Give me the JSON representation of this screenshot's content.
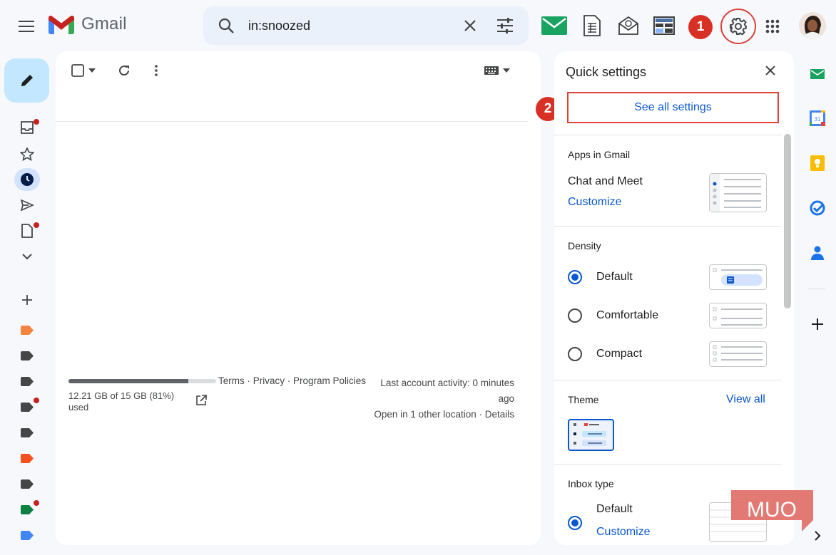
{
  "app": {
    "name": "Gmail"
  },
  "search": {
    "value": "in:snoozed"
  },
  "callouts": {
    "one": "1",
    "two": "2"
  },
  "storage": {
    "used_text": "12.21 GB of 15 GB (81%) used",
    "fraction": 0.81
  },
  "footer": {
    "links": "Terms · Privacy · Program Policies",
    "activity_line1": "Last account activity: 0 minutes",
    "activity_line2": "ago",
    "activity_line3": "Open in 1 other location · Details"
  },
  "quick_settings": {
    "title": "Quick settings",
    "see_all": "See all settings",
    "apps_label": "Apps in Gmail",
    "chat_meet": "Chat and Meet",
    "customize": "Customize",
    "density_label": "Density",
    "density_options": [
      "Default",
      "Comfortable",
      "Compact"
    ],
    "density_selected": "Default",
    "theme_label": "Theme",
    "theme_view_all": "View all",
    "inbox_type_label": "Inbox type",
    "inbox_default": "Default",
    "inbox_customize": "Customize"
  },
  "watermark": "MUO",
  "colors": {
    "accent": "#0b57d0",
    "callout": "#d93025",
    "compose": "#c2e7ff"
  }
}
